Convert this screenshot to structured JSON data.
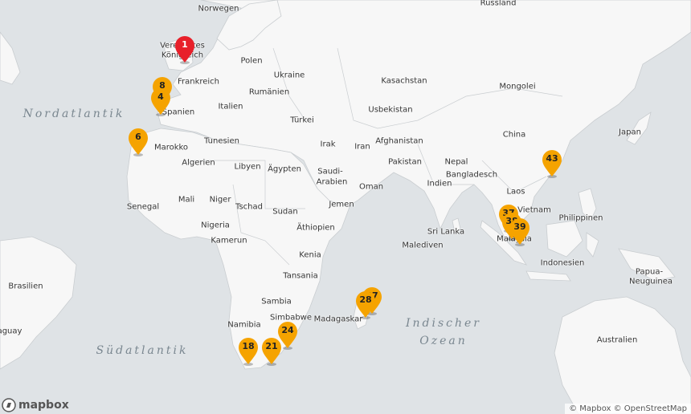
{
  "country_labels": [
    {
      "key": "russland",
      "text": "Russland"
    },
    {
      "key": "norwegen",
      "text": "Norwegen"
    },
    {
      "key": "vk1",
      "text": "Vereinigtes"
    },
    {
      "key": "vk2",
      "text": "Königreich"
    },
    {
      "key": "polen",
      "text": "Polen"
    },
    {
      "key": "ukraine",
      "text": "Ukraine"
    },
    {
      "key": "kasachstan",
      "text": "Kasachstan"
    },
    {
      "key": "mongolei",
      "text": "Mongolei"
    },
    {
      "key": "frankreich",
      "text": "Frankreich"
    },
    {
      "key": "rumaenien",
      "text": "Rumänien"
    },
    {
      "key": "italien",
      "text": "Italien"
    },
    {
      "key": "usbekistan",
      "text": "Usbekistan"
    },
    {
      "key": "spanien",
      "text": "Spanien"
    },
    {
      "key": "tuerkei",
      "text": "Türkei"
    },
    {
      "key": "china",
      "text": "China"
    },
    {
      "key": "japan",
      "text": "Japan"
    },
    {
      "key": "marokko",
      "text": "Marokko"
    },
    {
      "key": "tunesien",
      "text": "Tunesien"
    },
    {
      "key": "irak",
      "text": "Irak"
    },
    {
      "key": "iran",
      "text": "Iran"
    },
    {
      "key": "afghanistan",
      "text": "Afghanistan"
    },
    {
      "key": "algerien",
      "text": "Algerien"
    },
    {
      "key": "libyen",
      "text": "Libyen"
    },
    {
      "key": "aegypten",
      "text": "Ägypten"
    },
    {
      "key": "pakistan",
      "text": "Pakistan"
    },
    {
      "key": "nepal",
      "text": "Nepal"
    },
    {
      "key": "saudi1",
      "text": "Saudi-"
    },
    {
      "key": "saudi2",
      "text": "Arabien"
    },
    {
      "key": "bangladesch",
      "text": "Bangladesch"
    },
    {
      "key": "indien",
      "text": "Indien"
    },
    {
      "key": "oman",
      "text": "Oman"
    },
    {
      "key": "mali",
      "text": "Mali"
    },
    {
      "key": "niger",
      "text": "Niger"
    },
    {
      "key": "laos",
      "text": "Laos"
    },
    {
      "key": "senegal",
      "text": "Senegal"
    },
    {
      "key": "tschad",
      "text": "Tschad"
    },
    {
      "key": "sudan",
      "text": "Sudan"
    },
    {
      "key": "jemen",
      "text": "Jemen"
    },
    {
      "key": "vietnam",
      "text": "Vietnam"
    },
    {
      "key": "philippinen",
      "text": "Philippinen"
    },
    {
      "key": "nigeria",
      "text": "Nigeria"
    },
    {
      "key": "aethiopien",
      "text": "Äthiopien"
    },
    {
      "key": "srilanka",
      "text": "Sri Lanka"
    },
    {
      "key": "kamerun",
      "text": "Kamerun"
    },
    {
      "key": "malediven",
      "text": "Malediven"
    },
    {
      "key": "malaysia",
      "text": "Malaysia"
    },
    {
      "key": "kenia",
      "text": "Kenia"
    },
    {
      "key": "indonesien",
      "text": "Indonesien"
    },
    {
      "key": "papua1",
      "text": "Papua-"
    },
    {
      "key": "papua2",
      "text": "Neuguinea"
    },
    {
      "key": "tansania",
      "text": "Tansania"
    },
    {
      "key": "brasilien",
      "text": "Brasilien"
    },
    {
      "key": "sambia",
      "text": "Sambia"
    },
    {
      "key": "madagaskar",
      "text": "Madagaskar"
    },
    {
      "key": "simbabwe",
      "text": "Simbabwe"
    },
    {
      "key": "namibia",
      "text": "Namibia"
    },
    {
      "key": "australien",
      "text": "Australien"
    },
    {
      "key": "paraguay",
      "text": "aguay"
    }
  ],
  "ocean_labels": [
    {
      "key": "nordatlantik",
      "text": "Nordatlantik"
    },
    {
      "key": "suedatlantik",
      "text": "Südatlantik"
    },
    {
      "key": "indischer1",
      "text": "Indischer"
    },
    {
      "key": "indischer2",
      "text": "Ozean"
    }
  ],
  "markers": [
    {
      "key": "m1",
      "label": "1",
      "color": "#e8202a"
    },
    {
      "key": "m8",
      "label": "8",
      "color": "#f5a300"
    },
    {
      "key": "m4",
      "label": "4",
      "color": "#f5a300"
    },
    {
      "key": "m6",
      "label": "6",
      "color": "#f5a300"
    },
    {
      "key": "m43",
      "label": "43",
      "color": "#f5a300"
    },
    {
      "key": "m37",
      "label": "37",
      "color": "#f5a300"
    },
    {
      "key": "m38",
      "label": "38",
      "color": "#f5a300"
    },
    {
      "key": "m39",
      "label": "39",
      "color": "#f5a300"
    },
    {
      "key": "m27",
      "label": "27",
      "color": "#f5a300"
    },
    {
      "key": "m28",
      "label": "28",
      "color": "#f5a300"
    },
    {
      "key": "m24",
      "label": "24",
      "color": "#f5a300"
    },
    {
      "key": "m18",
      "label": "18",
      "color": "#f5a300"
    },
    {
      "key": "m21",
      "label": "21",
      "color": "#f5a300"
    }
  ],
  "logo_text": "mapbox",
  "attribution": "© Mapbox © OpenStreetMap",
  "colors": {
    "land": "#f7f7f7",
    "water": "#dfe3e6",
    "border": "#bfc4c8",
    "pin_primary": "#e8202a",
    "pin_secondary": "#f5a300"
  }
}
